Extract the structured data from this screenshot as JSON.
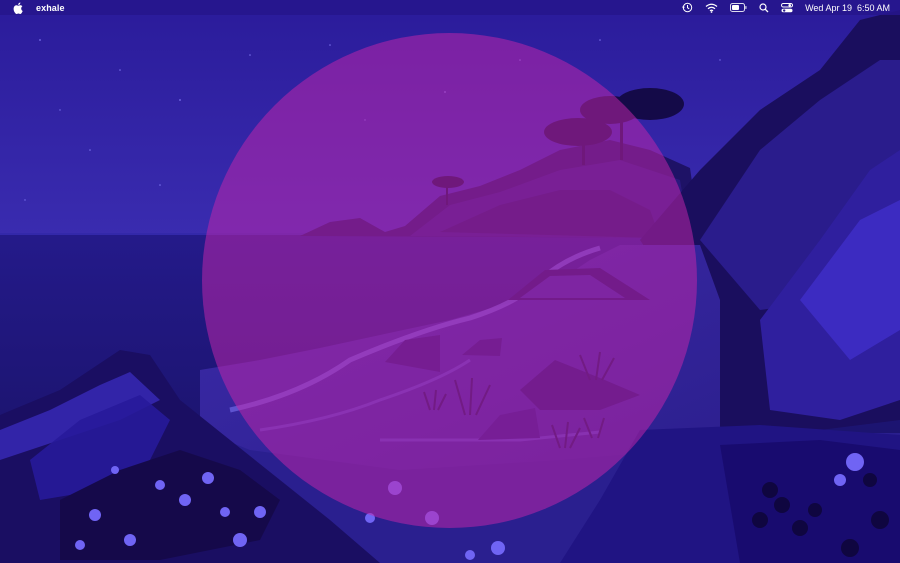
{
  "menubar": {
    "app_name": "exhale",
    "icons": [
      "apple-icon",
      "time-machine-icon",
      "wifi-icon",
      "battery-icon",
      "spotlight-icon",
      "control-center-icon"
    ],
    "clock_date": "Wed Apr 19",
    "clock_time": "6:50 AM"
  },
  "wallpaper": {
    "scene": "night-coast-landscape",
    "colors": {
      "sky": "#2d22a0",
      "sea": "#1f1880",
      "moon": "#c426aa",
      "cliff": "#1a0f5e",
      "sand": "#4a38b8",
      "flowers": "#6a5cf0"
    }
  }
}
